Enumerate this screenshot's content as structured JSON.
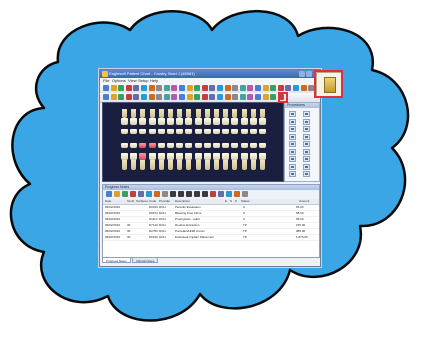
{
  "window": {
    "title": "Eaglesoft Patient Chart - Crosby, Brad J (#6981)",
    "menu": [
      "File",
      "Options",
      "View",
      "Setup",
      "Help"
    ]
  },
  "chart_panel": {
    "header": "Procedures"
  },
  "progress_notes": {
    "header": "Progress Notes",
    "columns": [
      "Date",
      "Tooth",
      "Surfaces",
      "Code",
      "Provider",
      "Description",
      "E",
      "S",
      "P",
      "Status",
      "Amount"
    ],
    "rows": [
      {
        "date": "06/02/2016",
        "tooth": "",
        "surfaces": "",
        "code": "D0150",
        "provider": "DOH",
        "description": "Periodic Evaluation",
        "status": "C",
        "amount": "65.00"
      },
      {
        "date": "06/02/2016",
        "tooth": "",
        "surfaces": "",
        "code": "D0274",
        "provider": "DOH",
        "description": "Bitewing Four Films",
        "status": "C",
        "amount": "58.00"
      },
      {
        "date": "06/02/2016",
        "tooth": "",
        "surfaces": "",
        "code": "D1110",
        "provider": "DOH",
        "description": "Prophylaxis - adult",
        "status": "C",
        "amount": "95.00"
      },
      {
        "date": "06/02/2016",
        "tooth": "30",
        "surfaces": "",
        "code": "D7140",
        "provider": "DOH",
        "description": "Routine Extraction",
        "status": "TP",
        "amount": "155.00"
      },
      {
        "date": "06/02/2016",
        "tooth": "30",
        "surfaces": "",
        "code": "D2750",
        "provider": "DOH",
        "description": "Porcelain/HNM Crown",
        "status": "TP",
        "amount": "985.00"
      },
      {
        "date": "06/02/2016",
        "tooth": "30",
        "surfaces": "",
        "code": "D6010",
        "provider": "DOH",
        "description": "Endosteal Implant Placement",
        "status": "TP",
        "amount": "1,875.00"
      }
    ]
  },
  "tabs": [
    "Progress Notes",
    "Clinical Notes"
  ],
  "colors": {
    "cloud_fill": "#3aa6e6",
    "cloud_outline": "#0a0a0a",
    "chart_bg": "#1a1f3f",
    "highlight": "#e03040"
  }
}
